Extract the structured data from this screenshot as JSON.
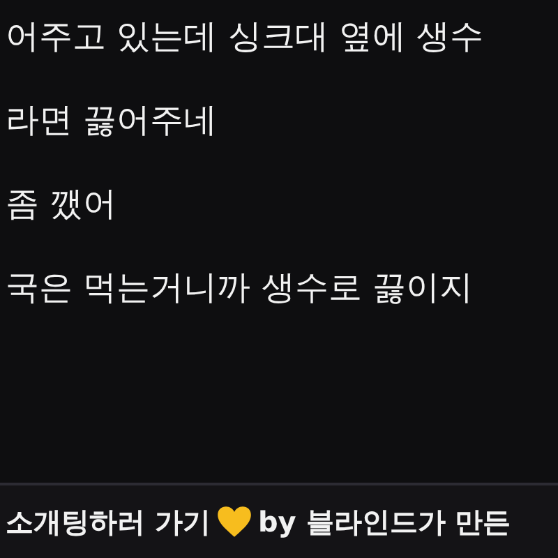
{
  "comment_lines": [
    "어주고 있는데 싱크대 옆에 생수",
    "라면 끓어주네",
    "좀 깼어",
    "국은 먹는거니까 생수로 끓이지"
  ],
  "banner": {
    "text_before": "소개팅하러 가기",
    "text_after": "by 블라인드가 만든"
  }
}
